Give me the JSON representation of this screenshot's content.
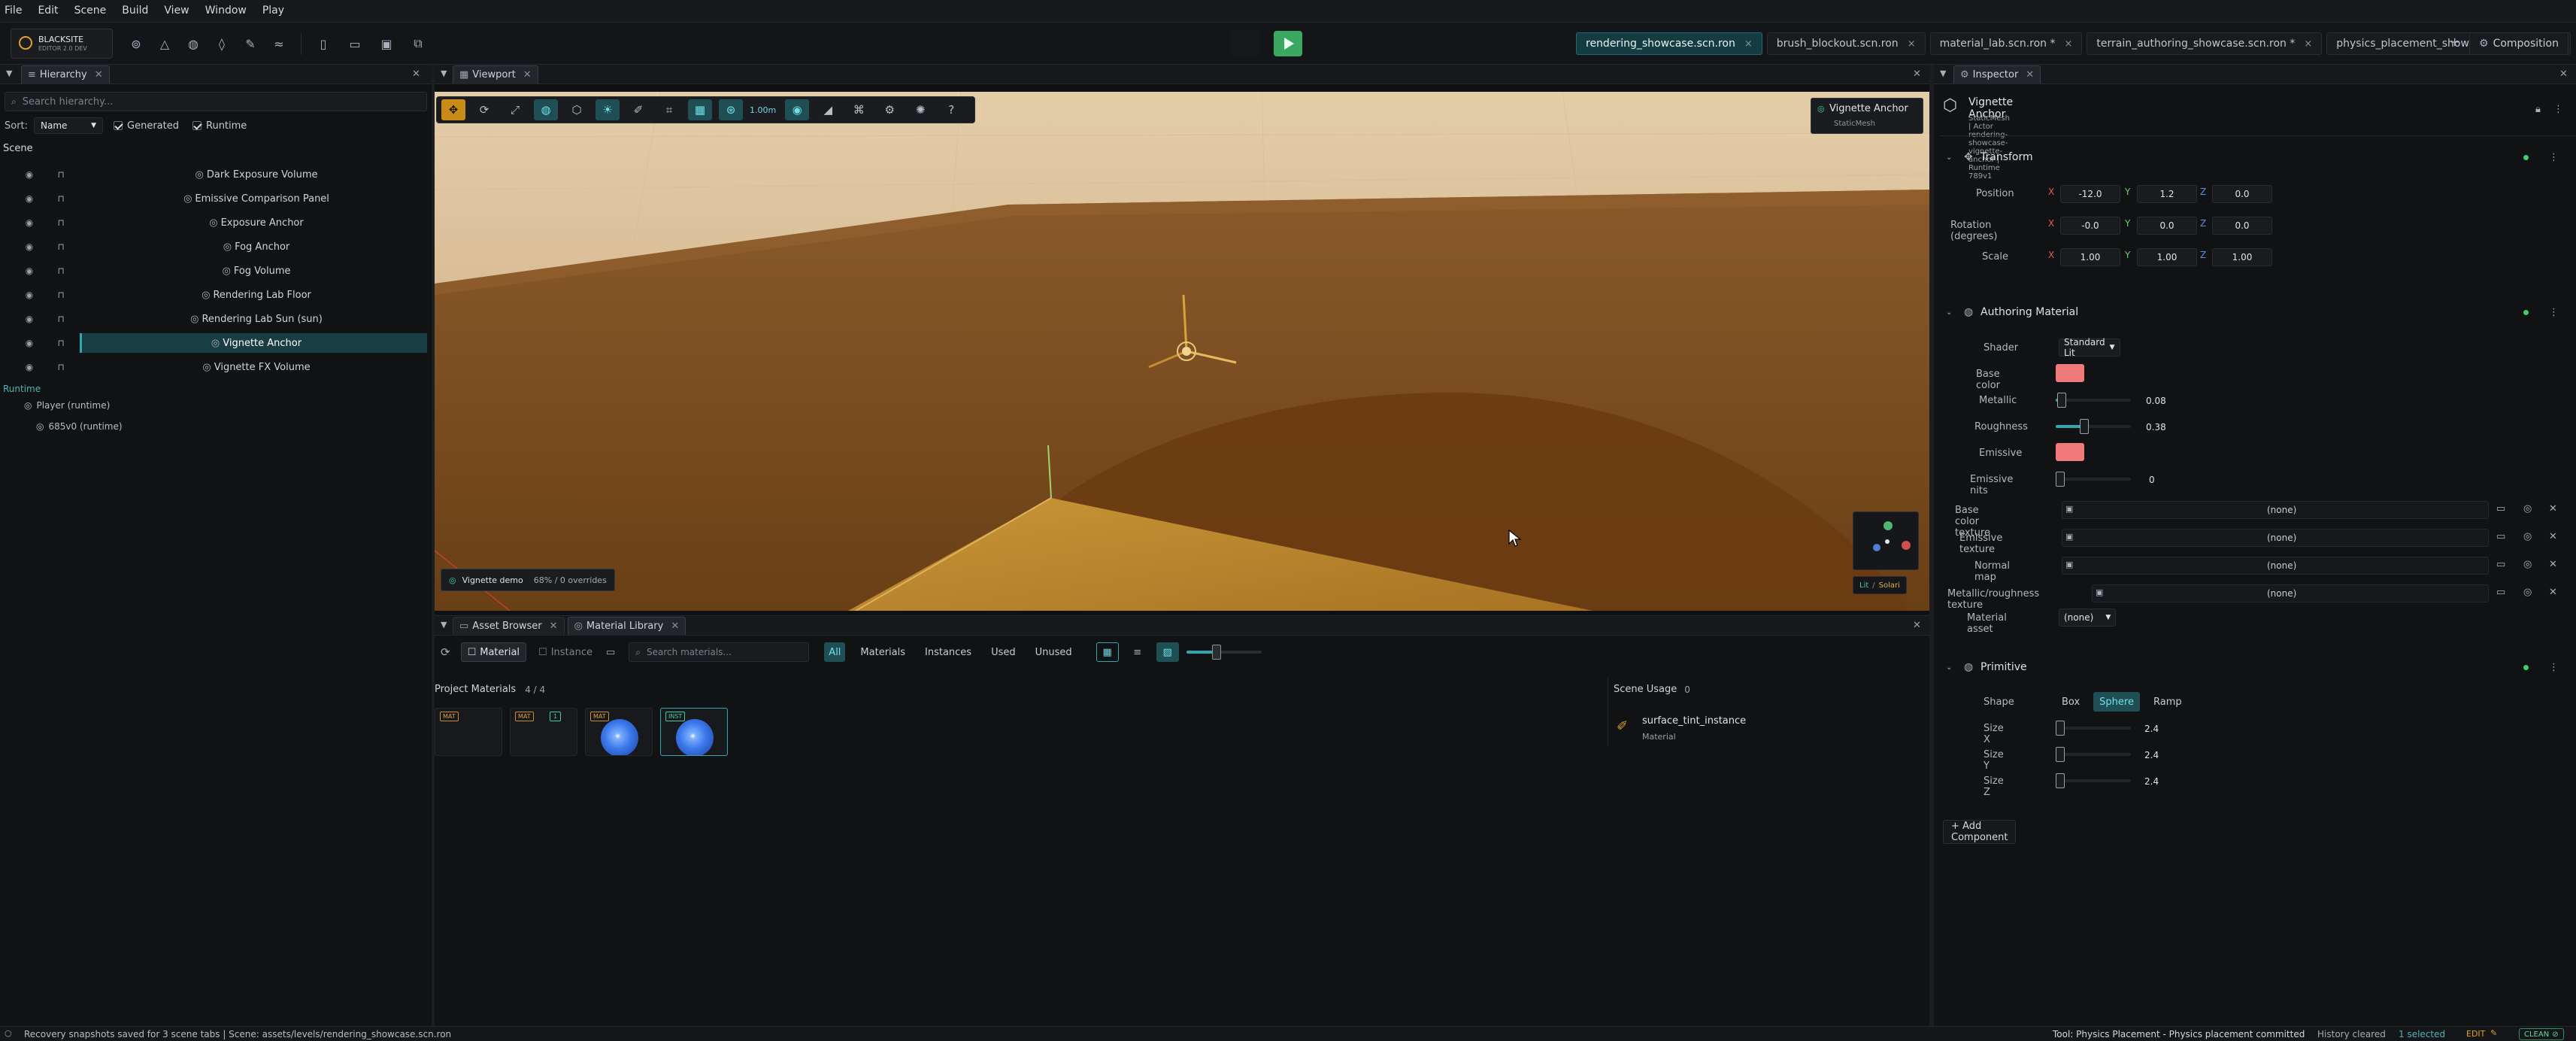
{
  "menu": [
    "File",
    "Edit",
    "Scene",
    "Build",
    "View",
    "Window",
    "Play"
  ],
  "brand": {
    "name": "BLACKSITE",
    "sub": "EDITOR 2.0 DEV"
  },
  "toolbar": {
    "doc_tabs": [
      {
        "label": "rendering_showcase.scn.ron",
        "active": true
      },
      {
        "label": "brush_blockout.scn.ron",
        "active": false
      },
      {
        "label": "material_lab.scn.ron *",
        "active": false
      },
      {
        "label": "terrain_authoring_showcase.scn.ron *",
        "active": false
      },
      {
        "label": "physics_placement_showcase.scn.ron *",
        "active": false
      }
    ],
    "new_tab": "+",
    "layout_button": "Composition",
    "tab_close": "×"
  },
  "hierarchy": {
    "tab": "Hierarchy",
    "search_placeholder": "Search hierarchy...",
    "sort_label": "Sort:",
    "sort_value": "Name",
    "generated_label": "Generated",
    "runtime_label": "Runtime",
    "scene_header": "Scene",
    "items": [
      {
        "name": "Dark Exposure Volume",
        "selected": false
      },
      {
        "name": "Emissive Comparison Panel",
        "selected": false
      },
      {
        "name": "Exposure Anchor",
        "selected": false
      },
      {
        "name": "Fog Anchor",
        "selected": false
      },
      {
        "name": "Fog Volume",
        "selected": false
      },
      {
        "name": "Rendering Lab Floor",
        "selected": false
      },
      {
        "name": "Rendering Lab Sun  (sun)",
        "selected": false
      },
      {
        "name": "Vignette Anchor",
        "selected": true
      },
      {
        "name": "Vignette FX Volume",
        "selected": false
      }
    ],
    "runtime_header": "Runtime",
    "runtime_items": [
      "Player  (runtime)",
      "685v0  (runtime)"
    ]
  },
  "viewport": {
    "tab": "Viewport",
    "grid_size": "1.00m",
    "selection_name": "Vignette Anchor",
    "selection_type": "StaticMesh",
    "demo_label": "Vignette demo",
    "demo_stats": "68% / 0 overrides",
    "render_mode_a": "Lit",
    "render_mode_sep": "/",
    "render_mode_b": "Solari"
  },
  "assets": {
    "tabs": [
      "Asset Browser",
      "Material Library"
    ],
    "active_tab": 1,
    "mode_buttons": [
      "Material",
      "Instance"
    ],
    "search_placeholder": "Search materials...",
    "filters": [
      "All",
      "Materials",
      "Instances",
      "Used",
      "Unused"
    ],
    "active_filter": 0,
    "project_label": "Project Materials",
    "project_count": "4  /  4",
    "thumb_badges": [
      "MAT",
      "MAT",
      "MAT",
      "INST"
    ],
    "thumb_extra_badge": "1",
    "usage_label": "Scene Usage",
    "usage_count": "0",
    "usage_item_name": "surface_tint_instance",
    "usage_item_type": "Material"
  },
  "inspector": {
    "tab": "Inspector",
    "object_name": "Vignette Anchor",
    "object_meta": "StaticMesh  |  Actor rendering-showcase-vignette-anchor  |  Runtime 789v1",
    "transform": {
      "title": "Transform",
      "rows": [
        {
          "label": "Position",
          "x": "-12.0",
          "y": "1.2",
          "z": "0.0"
        },
        {
          "label": "Rotation (degrees)",
          "x": "-0.0",
          "y": "0.0",
          "z": "0.0"
        },
        {
          "label": "Scale",
          "x": "1.00",
          "y": "1.00",
          "z": "1.00"
        }
      ],
      "axis_x": "X",
      "axis_y": "Y",
      "axis_z": "Z"
    },
    "material": {
      "title": "Authoring Material",
      "shader_label": "Shader",
      "shader_value": "Standard Lit",
      "base_color_label": "Base color",
      "base_color": "#f07a7a",
      "metallic_label": "Metallic",
      "metallic_value": "0.08",
      "metallic_fraction": 0.08,
      "roughness_label": "Roughness",
      "roughness_value": "0.38",
      "roughness_fraction": 0.38,
      "emissive_label": "Emissive",
      "emissive_color": "#f07a7a",
      "emissive_nits_label": "Emissive nits",
      "emissive_nits_value": "0",
      "textures": [
        {
          "label": "Base color texture",
          "value": "(none)"
        },
        {
          "label": "Emissive texture",
          "value": "(none)"
        },
        {
          "label": "Normal map",
          "value": "(none)"
        },
        {
          "label": "Metallic/roughness texture",
          "value": "(none)"
        }
      ],
      "material_asset_label": "Material asset",
      "material_asset_value": "(none)"
    },
    "primitive": {
      "title": "Primitive",
      "shape_label": "Shape",
      "shapes": [
        "Box",
        "Sphere",
        "Ramp"
      ],
      "active_shape": 1,
      "sizes": [
        {
          "label": "Size X",
          "value": "2.4"
        },
        {
          "label": "Size Y",
          "value": "2.4"
        },
        {
          "label": "Size Z",
          "value": "2.4"
        }
      ]
    },
    "add_component": "+ Add Component"
  },
  "status": {
    "left": "Recovery snapshots saved for 3 scene tabs  |  Scene: assets/levels/rendering_showcase.scn.ron",
    "tool": "Tool: Physics Placement - Physics placement committed",
    "history": "History cleared",
    "selection": "1 selected",
    "mode": "EDIT",
    "clean": "CLEAN"
  }
}
